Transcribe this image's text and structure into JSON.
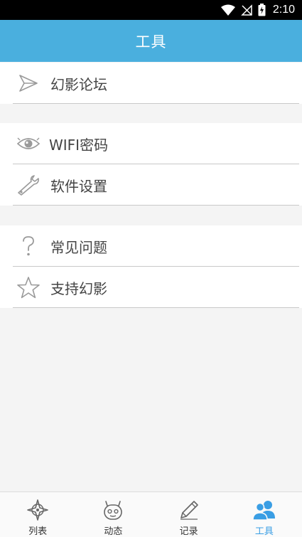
{
  "status_bar": {
    "time": "2:10",
    "icons": [
      "wifi-icon",
      "no-signal-icon",
      "battery-charging-icon"
    ]
  },
  "header": {
    "title": "工具"
  },
  "groups": [
    {
      "items": [
        {
          "label": "幻影论坛",
          "icon": "send-icon"
        }
      ]
    },
    {
      "items": [
        {
          "label": "WIFI密码",
          "icon": "eye-icon"
        },
        {
          "label": "软件设置",
          "icon": "wrench-icon"
        }
      ]
    },
    {
      "items": [
        {
          "label": "常见问题",
          "icon": "question-icon"
        },
        {
          "label": "支持幻影",
          "icon": "star-icon"
        }
      ]
    }
  ],
  "tabs": [
    {
      "label": "列表",
      "icon": "compass-icon",
      "active": false
    },
    {
      "label": "动态",
      "icon": "robot-icon",
      "active": false
    },
    {
      "label": "记录",
      "icon": "pencil-icon",
      "active": false
    },
    {
      "label": "工具",
      "icon": "users-icon",
      "active": true
    }
  ],
  "colors": {
    "accent": "#4aafde",
    "tab_active": "#3a9ee4",
    "background": "#f4f4f4"
  }
}
